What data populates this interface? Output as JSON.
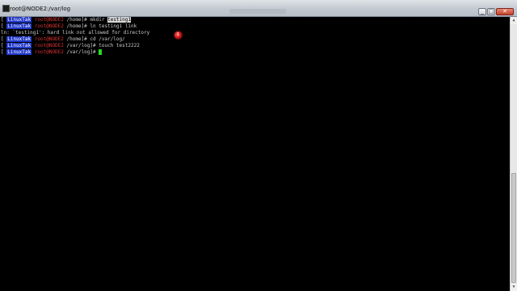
{
  "window": {
    "title": "root@NODE2:/var/log",
    "controls": {
      "minimize": "_",
      "maximize": "□",
      "close": "✕"
    }
  },
  "terminal": {
    "prompt": {
      "tag": "LinuxTak",
      "user_host": "root@NODE2"
    },
    "lines": [
      {
        "kind": "prompt",
        "cwd": " /home]# ",
        "command": "mkdir ",
        "selected": "testing1"
      },
      {
        "kind": "prompt",
        "cwd": " /home]# ",
        "command": "ln testing1 link"
      },
      {
        "kind": "output",
        "text": "ln: `testing1': hard link not allowed for directory"
      },
      {
        "kind": "prompt",
        "cwd": " /home]# ",
        "command": "cd /var/log/"
      },
      {
        "kind": "prompt",
        "cwd": " /var/log]# ",
        "command": "touch test2222"
      },
      {
        "kind": "prompt",
        "cwd": " /var/log]# ",
        "command": ""
      }
    ],
    "click_marker": "1"
  },
  "colors": {
    "tag_bg": "#1f36c8",
    "user_host": "#d23232",
    "cursor": "#22dd22",
    "background": "#000000"
  },
  "icons": {
    "app": "terminal-icon",
    "scroll_up": "arrow-up-icon",
    "scroll_down": "arrow-down-icon"
  }
}
